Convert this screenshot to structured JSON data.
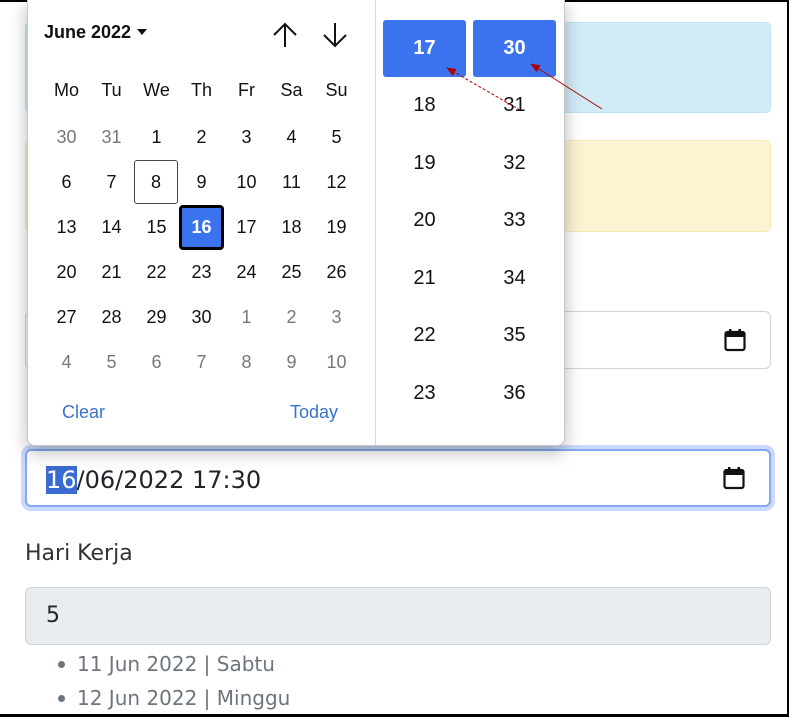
{
  "picker": {
    "month_label": "June 2022",
    "weekdays": [
      "Mo",
      "Tu",
      "We",
      "Th",
      "Fr",
      "Sa",
      "Su"
    ],
    "weeks": [
      [
        "30",
        "31",
        "1",
        "2",
        "3",
        "4",
        "5"
      ],
      [
        "6",
        "7",
        "8",
        "9",
        "10",
        "11",
        "12"
      ],
      [
        "13",
        "14",
        "15",
        "16",
        "17",
        "18",
        "19"
      ],
      [
        "20",
        "21",
        "22",
        "23",
        "24",
        "25",
        "26"
      ],
      [
        "27",
        "28",
        "29",
        "30",
        "1",
        "2",
        "3"
      ],
      [
        "4",
        "5",
        "6",
        "7",
        "8",
        "9",
        "10"
      ]
    ],
    "clear_label": "Clear",
    "today_label": "Today",
    "hours": [
      "17",
      "18",
      "19",
      "20",
      "21",
      "22",
      "23"
    ],
    "minutes": [
      "30",
      "31",
      "32",
      "33",
      "34",
      "35",
      "36"
    ]
  },
  "datetime_input": {
    "selected_part": "16",
    "rest": "/06/2022 17:30"
  },
  "work_days": {
    "label": "Hari Kerja",
    "value": "5"
  },
  "holidays": [
    "11 Jun 2022 | Sabtu",
    "12 Jun 2022 | Minggu"
  ],
  "colors": {
    "accent": "#3b73ee",
    "arrow": "#b00000"
  }
}
